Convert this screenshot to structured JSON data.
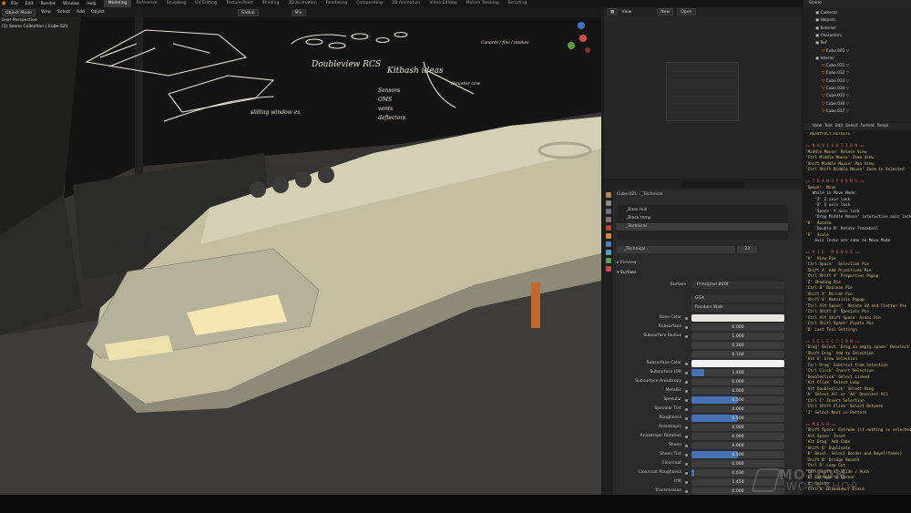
{
  "topbar": {
    "menus": [
      "File",
      "Edit",
      "Render",
      "Window",
      "Help"
    ],
    "workspaces": [
      "Modeling",
      "Reference",
      "Sculpting",
      "UV Editing",
      "Texture Paint",
      "Shading",
      "3D Animation",
      "Rendering",
      "Compositing",
      "2D Animation",
      "Video Editing",
      "Motion Tracking",
      "Scripting"
    ],
    "active_workspace": "Modeling"
  },
  "viewport": {
    "mode": "Object Mode",
    "menus": [
      "View",
      "Select",
      "Add",
      "Object"
    ],
    "transform": "Global",
    "overlay_label": "Mix",
    "view_name": "User Perspective",
    "collection": "(1) Scene Collection | Cube.021",
    "sketch_notes": [
      "Doubleview RCS",
      "Kitbash ideas",
      "Sensors",
      "OMS",
      "vents",
      "deflectors",
      "sliding window ex",
      "thruster ccw",
      "Canards / fins / intakes"
    ]
  },
  "uv_editor": {
    "menus": [
      "View"
    ],
    "new_label": "New",
    "open_label": "Open"
  },
  "properties": {
    "object_name": "Cube.021",
    "material_name": "_Technical",
    "slots": [
      "_Base Hull",
      "_Black temp",
      "_Technical"
    ],
    "active_slot": "_Technical",
    "users": "23",
    "preview_label": "Preview",
    "surface_header": "Surface",
    "surface_label": "Surface",
    "shader": "Principled BSDF",
    "distribution": "GGX",
    "subsurface_method": "Random Walk",
    "rows": [
      {
        "label": "Base Color",
        "kind": "color",
        "color": "#e7e5df"
      },
      {
        "label": "Subsurface",
        "kind": "value",
        "value": "0.000",
        "fill": 0
      },
      {
        "label": "Subsurface Radius",
        "kind": "value",
        "value": "1.000",
        "fill": 0
      },
      {
        "label": "",
        "kind": "value",
        "value": "0.200",
        "fill": 0
      },
      {
        "label": "",
        "kind": "value",
        "value": "0.100",
        "fill": 0
      },
      {
        "label": "Subsurface Color",
        "kind": "color",
        "color": "#f2f2f2"
      },
      {
        "label": "Subsurface IOR",
        "kind": "value",
        "value": "1.400",
        "fill": 0.14
      },
      {
        "label": "Subsurface Anisotropy",
        "kind": "value",
        "value": "0.000",
        "fill": 0
      },
      {
        "label": "Metallic",
        "kind": "value",
        "value": "0.000",
        "fill": 0
      },
      {
        "label": "Specular",
        "kind": "value",
        "value": "0.500",
        "fill": 0.5
      },
      {
        "label": "Specular Tint",
        "kind": "value",
        "value": "0.000",
        "fill": 0
      },
      {
        "label": "Roughness",
        "kind": "value",
        "value": "0.500",
        "fill": 0.5
      },
      {
        "label": "Anisotropic",
        "kind": "value",
        "value": "0.000",
        "fill": 0
      },
      {
        "label": "Anisotropic Rotation",
        "kind": "value",
        "value": "0.000",
        "fill": 0
      },
      {
        "label": "Sheen",
        "kind": "value",
        "value": "0.000",
        "fill": 0
      },
      {
        "label": "Sheen Tint",
        "kind": "value",
        "value": "0.500",
        "fill": 0.5
      },
      {
        "label": "Clearcoat",
        "kind": "value",
        "value": "0.000",
        "fill": 0
      },
      {
        "label": "Clearcoat Roughness",
        "kind": "value",
        "value": "0.030",
        "fill": 0.03
      },
      {
        "label": "IOR",
        "kind": "value",
        "value": "1.450",
        "fill": 0
      },
      {
        "label": "Transmission",
        "kind": "value",
        "value": "0.000",
        "fill": 0
      }
    ]
  },
  "outliner": {
    "title": "Scene",
    "items": [
      {
        "name": "Cameras",
        "indent": 1,
        "type": "collection"
      },
      {
        "name": "Helpers",
        "indent": 1,
        "type": "collection"
      },
      {
        "name": "Exterior",
        "indent": 1,
        "type": "collection"
      },
      {
        "name": "Characters",
        "indent": 1,
        "type": "collection"
      },
      {
        "name": "Ref",
        "indent": 1,
        "type": "collection"
      },
      {
        "name": "Cube.001",
        "indent": 2,
        "type": "mesh"
      },
      {
        "name": "Interior",
        "indent": 1,
        "type": "collection"
      },
      {
        "name": "Cube.031",
        "indent": 2,
        "type": "mesh"
      },
      {
        "name": "Cube.032",
        "indent": 2,
        "type": "mesh"
      },
      {
        "name": "Cube.033",
        "indent": 2,
        "type": "mesh"
      },
      {
        "name": "Cube.034",
        "indent": 2,
        "type": "mesh"
      },
      {
        "name": "Cube.035",
        "indent": 2,
        "type": "mesh"
      },
      {
        "name": "Cube.036",
        "indent": 2,
        "type": "mesh"
      },
      {
        "name": "Cube.037",
        "indent": 2,
        "type": "mesh"
      }
    ]
  },
  "text_editor": {
    "menus": [
      "View",
      "Text",
      "Edit",
      "Select",
      "Format",
      "Templ"
    ],
    "lines": [
      {
        "t": "' HEAVYPOLY HOTKEYS '",
        "c": "#c9a45a"
      },
      {
        "t": "",
        "c": "#ccc"
      },
      {
        "t": "== N A V I G A T I O N ==",
        "c": "#e0665a"
      },
      {
        "t": "'Middle Mouse' Rotate View",
        "c": "#d6c06a"
      },
      {
        "t": "'Ctrl Middle Mouse' Zoom View",
        "c": "#d6c06a"
      },
      {
        "t": "'Shift Middle Mouse' Pan View",
        "c": "#d6c06a"
      },
      {
        "t": "'Ctrl Shift Middle Mouse' Zoom to Selected",
        "c": "#d6c06a"
      },
      {
        "t": "",
        "c": "#ccc"
      },
      {
        "t": "== T R A N S F O R M S ==",
        "c": "#e0665a"
      },
      {
        "t": "'Space'  Move",
        "c": "#d6c06a"
      },
      {
        "t": "   While in Move Mode:",
        "c": "#cfcfcf"
      },
      {
        "t": "    'Z' Z axis lock",
        "c": "#cfcfcf"
      },
      {
        "t": "    'X' X axis lock",
        "c": "#cfcfcf"
      },
      {
        "t": "    'Space' Y axis lock",
        "c": "#cfcfcf"
      },
      {
        "t": "    'Drag Middle Mouse' interactive axis lock",
        "c": "#cfcfcf"
      },
      {
        "t": "'R'  Rotate",
        "c": "#d6c06a"
      },
      {
        "t": "    'Double R' Rotate Trackball",
        "c": "#cfcfcf"
      },
      {
        "t": "'S'  Scale",
        "c": "#d6c06a"
      },
      {
        "t": "    Axis locks are same as Move Mode",
        "c": "#cfcfcf"
      },
      {
        "t": "",
        "c": "#ccc"
      },
      {
        "t": "== P I E   M E N U S ==",
        "c": "#e0665a"
      },
      {
        "t": "'V'  View Pie",
        "c": "#d6c06a"
      },
      {
        "t": "'Ctrl Space'  Selection Pie",
        "c": "#d6c06a"
      },
      {
        "t": "'Shift A' Add Primitives Pie",
        "c": "#d6c06a"
      },
      {
        "t": "'Ctrl Shift V' Properties Popup",
        "c": "#d6c06a"
      },
      {
        "t": "'Z' Shading Pie",
        "c": "#d6c06a"
      },
      {
        "t": "'Ctrl B' Boolean Pie",
        "c": "#d6c06a"
      },
      {
        "t": "'Shift X' Mirror Pie",
        "c": "#d6c06a"
      },
      {
        "t": "'Shift V' Materials Popup",
        "c": "#d6c06a"
      },
      {
        "t": "'Ctrl Alt Space'  Rotate UV and Flatten Pie",
        "c": "#d6c06a"
      },
      {
        "t": "'Ctrl Shift D' Specials Pie",
        "c": "#d6c06a"
      },
      {
        "t": "'Ctrl Alt Shift Space' Areas Pie",
        "c": "#d6c06a"
      },
      {
        "t": "'Ctrl Shift Space' Pivots Pie",
        "c": "#d6c06a"
      },
      {
        "t": "'D' Last Tool Settings",
        "c": "#d6c06a"
      },
      {
        "t": "",
        "c": "#ccc"
      },
      {
        "t": "== S E L E C T I O N ==",
        "c": "#e0665a"
      },
      {
        "t": "'Drag' Select 'Drag on empty space' Deselect",
        "c": "#d6c06a"
      },
      {
        "t": "'Shift Drag' Add to Selection",
        "c": "#d6c06a"
      },
      {
        "t": "'Alt E' Grow Selection",
        "c": "#d6c06a"
      },
      {
        "t": "'Ctrl Drag' Subtract from Selection",
        "c": "#d6c06a"
      },
      {
        "t": "'Ctrl Click' Invert Selection",
        "c": "#d6c06a"
      },
      {
        "t": "'Doubleclick' Select Linked",
        "c": "#d6c06a"
      },
      {
        "t": "'Alt Click' Select Loop",
        "c": "#d6c06a"
      },
      {
        "t": "'Alt Doubleclick' Select Ring",
        "c": "#d6c06a"
      },
      {
        "t": "'A' Select All or 'AA' Deselect All",
        "c": "#d6c06a"
      },
      {
        "t": "'Ctrl I' Invert Selection",
        "c": "#d6c06a"
      },
      {
        "t": "'Ctrl Shift Click' Select Between",
        "c": "#d6c06a"
      },
      {
        "t": "'J' Select Next in Pattern",
        "c": "#d6c06a"
      },
      {
        "t": "",
        "c": "#ccc"
      },
      {
        "t": "== M E S H ==",
        "c": "#e0665a"
      },
      {
        "t": "'Shift Space' Extrude (if nothing is selected)",
        "c": "#d6c06a"
      },
      {
        "t": "'Alt Space' Inset",
        "c": "#d6c06a"
      },
      {
        "t": "'Alt Drag' Add Cube",
        "c": "#d6c06a"
      },
      {
        "t": "'Shift D' Duplicate",
        "c": "#d6c06a"
      },
      {
        "t": "'B' Bevel. Select Border and Bevel(faces)",
        "c": "#d6c06a"
      },
      {
        "t": "'Shift B' Bridge Smooth",
        "c": "#d6c06a"
      },
      {
        "t": "'Ctrl R' Loop Cut",
        "c": "#d6c06a"
      },
      {
        "t": "'Ctrl Shift V' Slide / Push",
        "c": "#d6c06a"
      },
      {
        "t": "'E' Extrude to Cursor",
        "c": "#d6c06a"
      },
      {
        "t": "'X' Delete",
        "c": "#d6c06a"
      },
      {
        "t": "'Ctrl X' Dissolve / Erase",
        "c": "#d6c06a"
      }
    ]
  },
  "watermark": {
    "line1": "MOTION",
    "line2": "WORKSHOP"
  }
}
